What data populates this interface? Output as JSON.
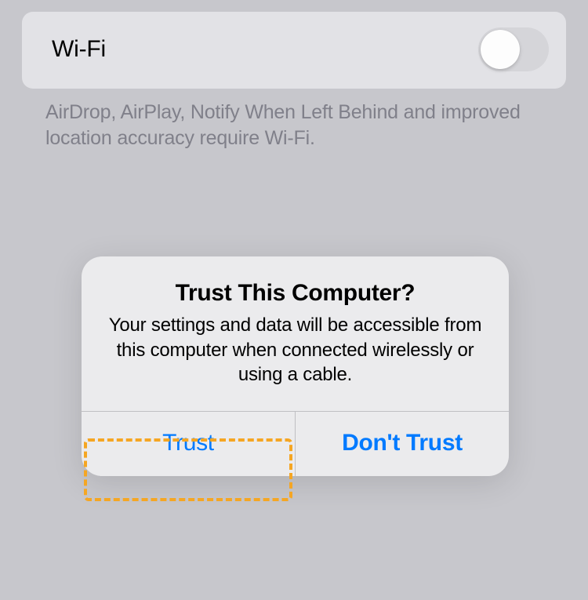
{
  "settings": {
    "wifi_label": "Wi-Fi",
    "wifi_enabled": false,
    "footer": "AirDrop, AirPlay, Notify When Left Behind and improved location accuracy require Wi-Fi."
  },
  "dialog": {
    "title": "Trust This Computer?",
    "message": "Your settings and data will be accessible from this computer when connected wirelessly or using a cable.",
    "trust_label": "Trust",
    "dont_trust_label": "Don't Trust"
  }
}
